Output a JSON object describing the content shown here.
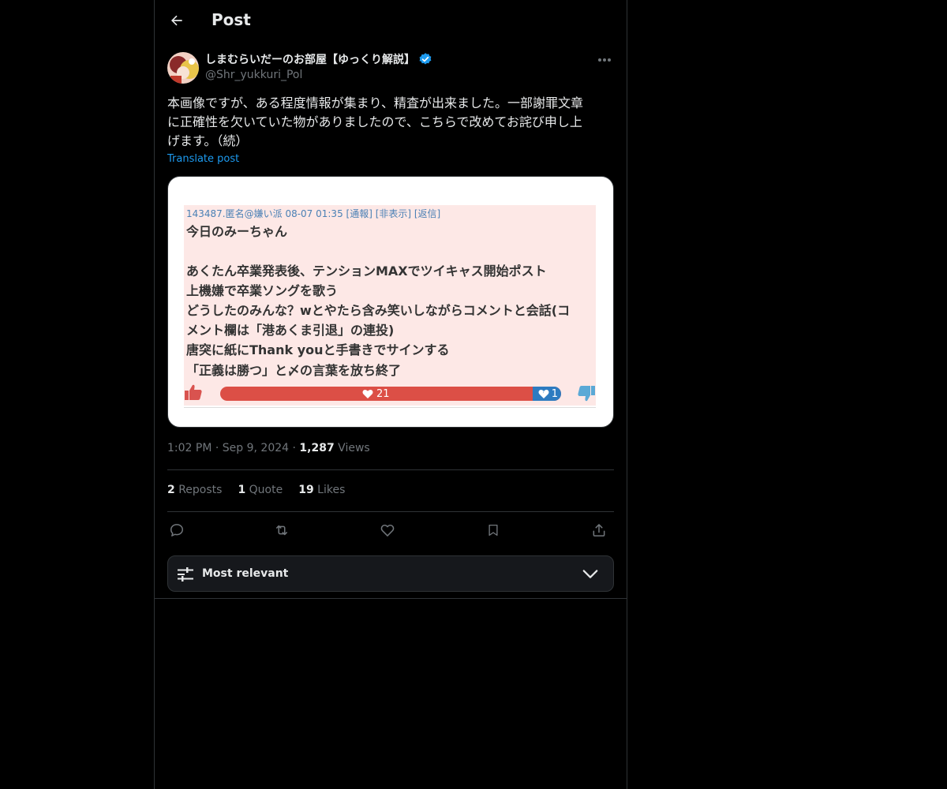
{
  "header": {
    "title": "Post"
  },
  "author": {
    "display_name": "しまむらいだーのお部屋【ゆっくり解説】",
    "handle": "@Shr_yukkuri_Pol",
    "verified": true
  },
  "post": {
    "text_lines": [
      "本画像ですが、ある程度情報が集まり、精査が出来ました。一部謝罪文章",
      "に正確性を欠いていた物がありましたので、こちらで改めてお詫び申し上",
      "げます。（続）"
    ],
    "translate_label": "Translate post"
  },
  "media": {
    "meta": "143487.匿名@嫌い派 08-07 01:35 [通報] [非表示] [返信]",
    "lines": [
      "今日のみーちゃん",
      "",
      "あくたん卒業発表後、テンションMAXでツイキャス開始ポスト",
      "上機嫌で卒業ソングを歌う",
      "どうしたのみんな？wとやたら含み笑いしながらコメントと会話(コ",
      "メント欄は「港あくま引退」の連投)",
      "唐突に紙にThank youと手書きでサインする",
      "「正義は勝つ」と〆の言葉を放ち終了"
    ],
    "likes": "21",
    "dislikes": "1"
  },
  "timestamp": {
    "time": "1:02 PM",
    "sep": "·",
    "date": "Sep 9, 2024",
    "views_count": "1,287",
    "views_label": "Views"
  },
  "stats": [
    {
      "count": "2",
      "label": "Reposts"
    },
    {
      "count": "1",
      "label": "Quote"
    },
    {
      "count": "19",
      "label": "Likes"
    }
  ],
  "sort": {
    "label": "Most relevant"
  },
  "colors": {
    "accent": "#1d9bf0",
    "background": "#000000",
    "border": "#2f3336",
    "muted": "#71767b"
  }
}
